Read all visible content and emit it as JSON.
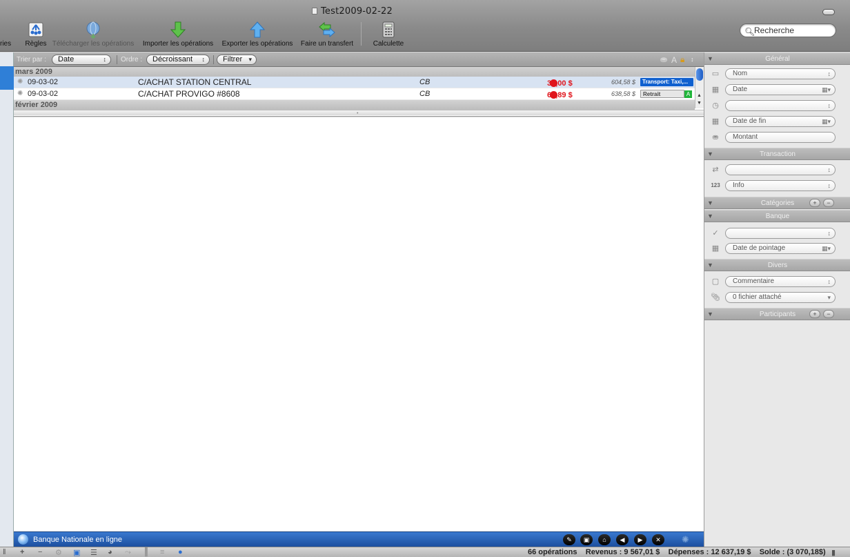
{
  "window": {
    "title": "Test2009-02-22"
  },
  "toolbar": {
    "left_cut_label": "ries",
    "buttons": [
      {
        "id": "rules",
        "label": "Règles",
        "icon": "rules-icon",
        "enabled": true
      },
      {
        "id": "download",
        "label": "Télécharger les opérations",
        "icon": "globe-download-icon",
        "enabled": false
      },
      {
        "id": "import",
        "label": "Importer les opérations",
        "icon": "arrow-down-icon",
        "enabled": true
      },
      {
        "id": "export",
        "label": "Exporter les opérations",
        "icon": "arrow-up-icon",
        "enabled": true
      },
      {
        "id": "transfer",
        "label": "Faire un transfert",
        "icon": "transfer-arrows-icon",
        "enabled": true
      },
      {
        "id": "calculator",
        "label": "Calculette",
        "icon": "calculator-icon",
        "enabled": true
      }
    ],
    "search_placeholder": "Recherche"
  },
  "sortbar": {
    "sort_label": "Trier par :",
    "sort_value": "Date",
    "order_label": "Ordre :",
    "order_value": "Décroissant",
    "filter_label": "Filtrer",
    "font_icon_label": "A"
  },
  "transactions": {
    "groups": [
      {
        "month": "mars 2009",
        "rows": [
          {
            "date": "09-03-02",
            "payee": "C/ACHAT STATION CENTRAL",
            "mode": "CB",
            "amount": "34,00 $",
            "balance": "604,58 $",
            "category": "Transport: Taxi,...",
            "category_style": "blue",
            "selected": true
          },
          {
            "date": "09-03-02",
            "payee": "C/ACHAT PROVIGO #8608",
            "mode": "CB",
            "amount": "68,89 $",
            "balance": "638,58 $",
            "category": "Retrait",
            "category_style": "gray",
            "badge": "A",
            "selected": false
          }
        ]
      },
      {
        "month": "février 2009",
        "rows": []
      }
    ]
  },
  "bankbar": {
    "bank_name": "Banque Nationale en ligne"
  },
  "statusbar": {
    "operations": "66 opérations",
    "revenue": "Revenus : 9 567,01 $",
    "expenses": "Dépenses : 12 637,19 $",
    "balance": "Solde : (3 070,18$)"
  },
  "inspector": {
    "general": {
      "title": "Général",
      "fields": {
        "name": "Nom",
        "date": "Date",
        "time": "",
        "end_date": "Date de fin",
        "amount": "Montant"
      }
    },
    "transaction": {
      "title": "Transaction",
      "fields": {
        "type": "",
        "info": "Info",
        "info_icon_text": "123"
      }
    },
    "categories": {
      "title": "Catégories",
      "add": "+",
      "remove": "−"
    },
    "bank": {
      "title": "Banque",
      "fields": {
        "status": "",
        "clearing_date": "Date de pointage"
      }
    },
    "misc": {
      "title": "Divers",
      "fields": {
        "comment": "Commentaire",
        "attachment": "0 fichier attaché"
      }
    },
    "participants": {
      "title": "Participants",
      "add": "+",
      "remove": "−"
    }
  },
  "colors": {
    "accent_blue": "#1c5cc4",
    "expense_red": "#e0141b",
    "category_blue": "#0f60cf",
    "badge_green": "#21b53b"
  }
}
